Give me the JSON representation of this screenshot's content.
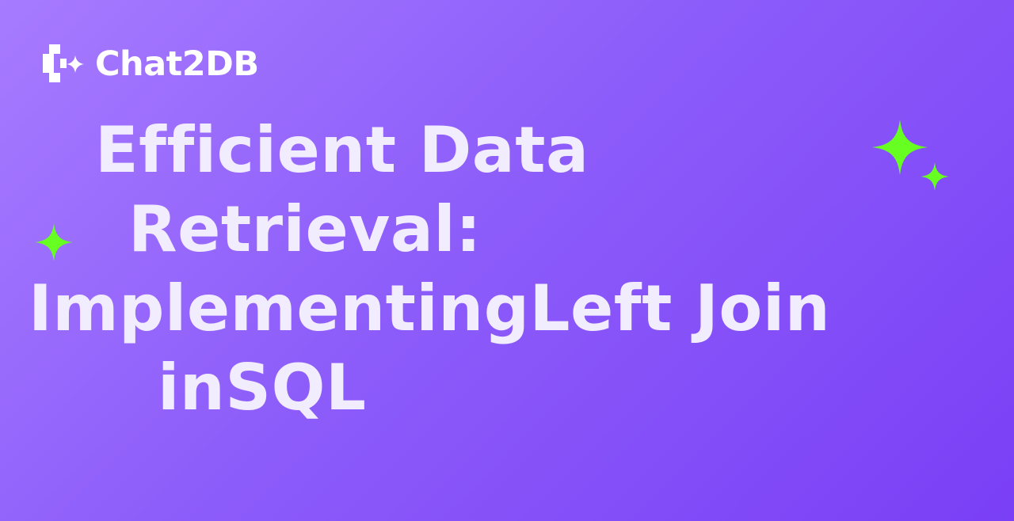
{
  "brand": {
    "name": "Chat2DB",
    "logo_icon": "chat2db-logo-icon"
  },
  "headline": {
    "lines": [
      "Efficient Data",
      "Retrieval:",
      "ImplementingLeft Join",
      "inSQL"
    ]
  },
  "decorations": {
    "sparkle_icon": "sparkle-icon",
    "sparkle_color": "#67FF22"
  },
  "colors": {
    "background_start": "#A77BFF",
    "background_end": "#7A3FF6",
    "headline_text": "#F2ECFF",
    "logo_text": "#FFFFFF"
  }
}
